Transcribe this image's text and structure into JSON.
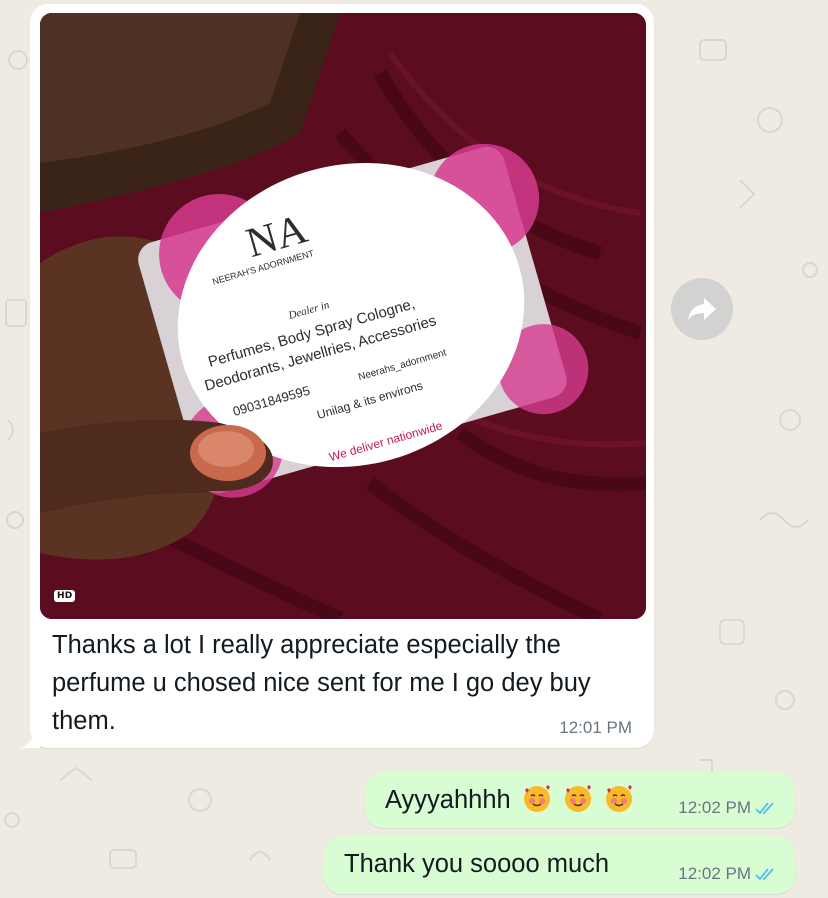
{
  "incoming": {
    "image_badge": "HD",
    "photo": {
      "brand_initials": "NA",
      "brand_name": "NEERAH'S ADORNMENT",
      "dealer_label": "Dealer in",
      "line1": "Perfumes, Body Spray Cologne,",
      "line2": "Deodorants, Jewellries, Accessories",
      "phone": "09031849595",
      "instagram": "Neerahs_adornment",
      "location": "Unilag & its environs",
      "tagline": "We deliver nationwide"
    },
    "caption": "Thanks a lot I really appreciate especially the perfume u chosed nice sent for me I go dey buy them.",
    "time": "12:01 PM"
  },
  "outgoing": [
    {
      "text": "Ayyyahhhh",
      "emoji_count": 3,
      "emoji": "smiling-face-with-hearts",
      "time": "12:02 PM",
      "status": "read"
    },
    {
      "text": "Thank you soooo much",
      "time": "12:02 PM",
      "status": "read"
    }
  ],
  "colors": {
    "wallpaper": "#efeae2",
    "incoming_bubble": "#ffffff",
    "outgoing_bubble": "#d9fdd3",
    "read_tick": "#53bdeb",
    "timestamp": "#667781"
  }
}
